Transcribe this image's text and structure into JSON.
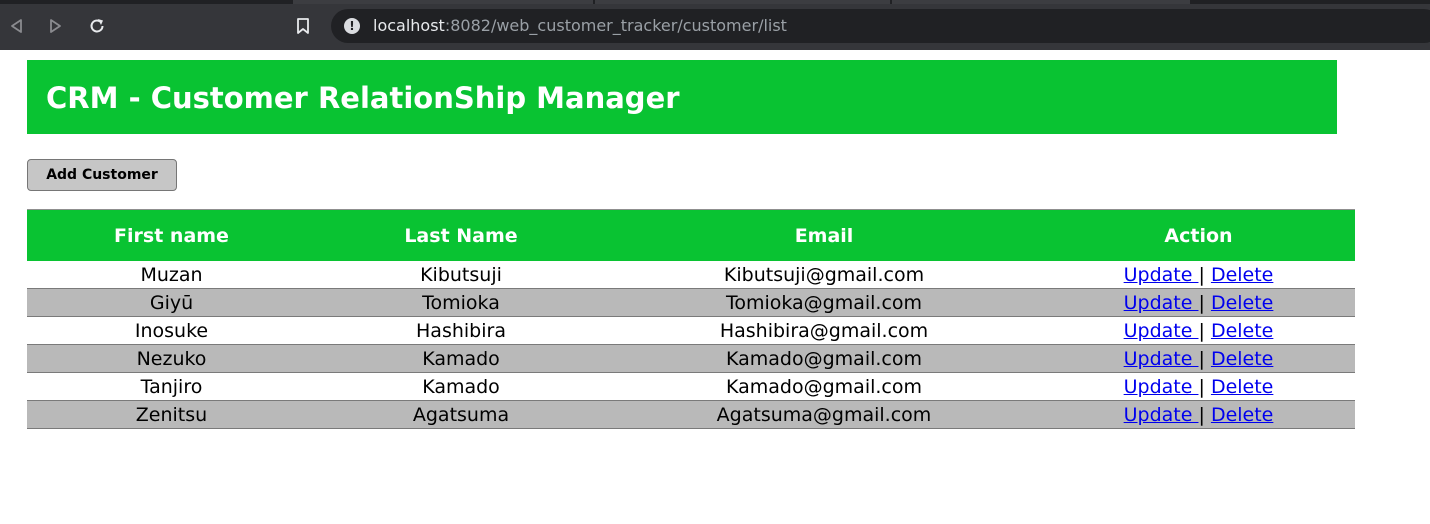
{
  "browser": {
    "url_host": "localhost",
    "url_path": ":8082/web_customer_tracker/customer/list"
  },
  "header": {
    "title": "CRM - Customer RelationShip Manager"
  },
  "toolbar": {
    "add_label": "Add Customer"
  },
  "table": {
    "columns": [
      "First name",
      "Last Name",
      "Email",
      "Action"
    ],
    "rows": [
      {
        "first": "Muzan",
        "last": "Kibutsuji",
        "email": "Kibutsuji@gmail.com",
        "update": "Update ",
        "sep": "|",
        "delete": "Delete"
      },
      {
        "first": "Giyū",
        "last": "Tomioka",
        "email": "Tomioka@gmail.com",
        "update": "Update ",
        "sep": "|",
        "delete": "Delete"
      },
      {
        "first": "Inosuke",
        "last": "Hashibira",
        "email": "Hashibira@gmail.com",
        "update": "Update ",
        "sep": "|",
        "delete": "Delete"
      },
      {
        "first": "Nezuko",
        "last": "Kamado",
        "email": "Kamado@gmail.com",
        "update": "Update ",
        "sep": "|",
        "delete": "Delete"
      },
      {
        "first": "Tanjiro",
        "last": "Kamado",
        "email": "Kamado@gmail.com",
        "update": "Update ",
        "sep": "|",
        "delete": "Delete"
      },
      {
        "first": "Zenitsu",
        "last": "Agatsuma",
        "email": "Agatsuma@gmail.com",
        "update": "Update ",
        "sep": "|",
        "delete": "Delete"
      }
    ]
  },
  "colors": {
    "brand_green": "#09c332",
    "row_alt": "#b9b9b9",
    "link": "#0000ee"
  },
  "icons": {
    "back": "back-arrow-icon",
    "forward": "forward-arrow-icon",
    "reload": "reload-icon",
    "bookmark": "bookmark-icon",
    "site_info": "info-icon"
  }
}
